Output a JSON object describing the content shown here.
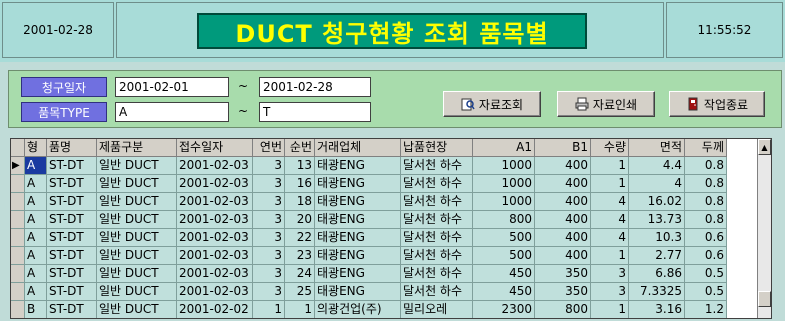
{
  "header": {
    "date": "2001-02-28",
    "title": "DUCT 청구현황 조회 품목별",
    "time": "11:55:52"
  },
  "filters": {
    "claim_date_label": "청구일자",
    "claim_date_from": "2001-02-01",
    "claim_date_to": "2001-02-28",
    "type_label": "품목TYPE",
    "type_from": "A",
    "type_to": "T",
    "range_sep": "~"
  },
  "buttons": {
    "query": "자료조회",
    "print": "자료인쇄",
    "exit": "작업종료"
  },
  "grid": {
    "columns": [
      "형",
      "품명",
      "제품구분",
      "접수일자",
      "연번",
      "순번",
      "거래업체",
      "납품현장",
      "A1",
      "B1",
      "수량",
      "면적",
      "두께"
    ],
    "rows": [
      [
        "A",
        "ST-DT",
        "일반 DUCT",
        "2001-02-03",
        "3",
        "13",
        "태광ENG",
        "달서천 하수",
        "1000",
        "400",
        "1",
        "4.4",
        "0.8"
      ],
      [
        "A",
        "ST-DT",
        "일반 DUCT",
        "2001-02-03",
        "3",
        "16",
        "태광ENG",
        "달서천 하수",
        "1000",
        "400",
        "1",
        "4",
        "0.8"
      ],
      [
        "A",
        "ST-DT",
        "일반 DUCT",
        "2001-02-03",
        "3",
        "18",
        "태광ENG",
        "달서천 하수",
        "1000",
        "400",
        "4",
        "16.02",
        "0.8"
      ],
      [
        "A",
        "ST-DT",
        "일반 DUCT",
        "2001-02-03",
        "3",
        "20",
        "태광ENG",
        "달서천 하수",
        "800",
        "400",
        "4",
        "13.73",
        "0.8"
      ],
      [
        "A",
        "ST-DT",
        "일반 DUCT",
        "2001-02-03",
        "3",
        "22",
        "태광ENG",
        "달서천 하수",
        "500",
        "400",
        "4",
        "10.3",
        "0.6"
      ],
      [
        "A",
        "ST-DT",
        "일반 DUCT",
        "2001-02-03",
        "3",
        "23",
        "태광ENG",
        "달서천 하수",
        "500",
        "400",
        "1",
        "2.77",
        "0.6"
      ],
      [
        "A",
        "ST-DT",
        "일반 DUCT",
        "2001-02-03",
        "3",
        "24",
        "태광ENG",
        "달서천 하수",
        "450",
        "350",
        "3",
        "6.86",
        "0.5"
      ],
      [
        "A",
        "ST-DT",
        "일반 DUCT",
        "2001-02-03",
        "3",
        "25",
        "태광ENG",
        "달서천 하수",
        "450",
        "350",
        "3",
        "7.3325",
        "0.5"
      ],
      [
        "B",
        "ST-DT",
        "일반 DUCT",
        "2001-02-02",
        "1",
        "1",
        "의광건업(주)",
        "밀리오레",
        "2300",
        "800",
        "1",
        "3.16",
        "1.2"
      ]
    ]
  },
  "colors": {
    "title_bg": "#009a7c",
    "title_text": "#ffff00",
    "label_bg": "#7070e0",
    "row_bg": "#c0e0dc"
  }
}
